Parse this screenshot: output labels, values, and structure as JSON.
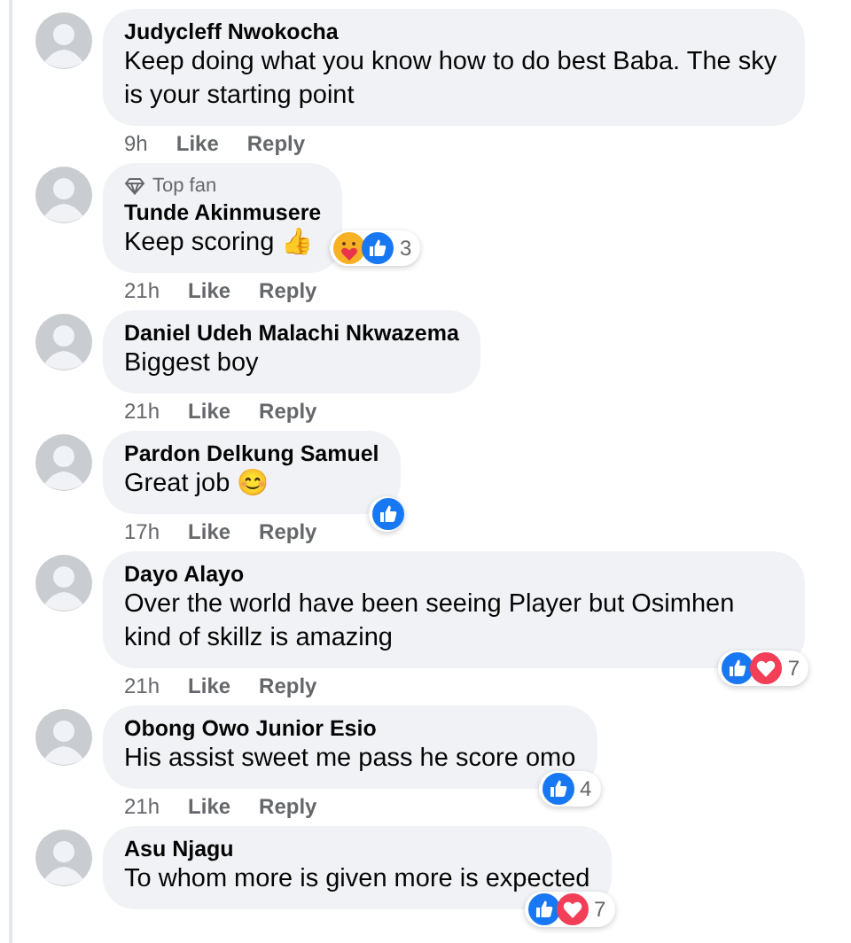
{
  "comments": [
    {
      "name": "Judycleff Nwokocha",
      "text": "Keep doing what you know how to do best Baba. The sky is your starting point",
      "meta": {
        "time": "9h",
        "like": "Like",
        "reply": "Reply"
      }
    },
    {
      "badge": "Top fan",
      "name": "Tunde Akinmusere",
      "text": "Keep scoring 👍",
      "reactions": {
        "kind": "beside",
        "icons": [
          {
            "kind": "care"
          },
          {
            "kind": "like"
          }
        ],
        "count": "3"
      },
      "meta": {
        "time": "21h",
        "like": "Like",
        "reply": "Reply"
      }
    },
    {
      "name": "Daniel Udeh Malachi Nkwazema",
      "text": "Biggest boy",
      "meta": {
        "time": "21h",
        "like": "Like",
        "reply": "Reply"
      }
    },
    {
      "name": "Pardon Delkung Samuel",
      "text": "Great job 😊",
      "reactions": {
        "kind": "corner",
        "icons": [
          {
            "kind": "like"
          }
        ]
      },
      "meta": {
        "time": "17h",
        "like": "Like",
        "reply": "Reply"
      }
    },
    {
      "name": "Dayo Alayo",
      "text": "Over the world have been seeing Player but Osimhen kind of skillz is amazing",
      "reactions": {
        "kind": "corner",
        "icons": [
          {
            "kind": "like"
          },
          {
            "kind": "love"
          }
        ],
        "count": "7"
      },
      "meta": {
        "time": "21h",
        "like": "Like",
        "reply": "Reply"
      }
    },
    {
      "name": "Obong Owo Junior Esio",
      "text": "His assist sweet me pass he score omo",
      "reactions": {
        "kind": "corner",
        "icons": [
          {
            "kind": "like"
          }
        ],
        "count": "4"
      },
      "meta": {
        "time": "21h",
        "like": "Like",
        "reply": "Reply"
      }
    },
    {
      "name": "Asu Njagu",
      "text": "To whom more is given more is expected",
      "reactions": {
        "kind": "corner",
        "icons": [
          {
            "kind": "like"
          },
          {
            "kind": "love"
          }
        ],
        "count": "7"
      }
    }
  ]
}
